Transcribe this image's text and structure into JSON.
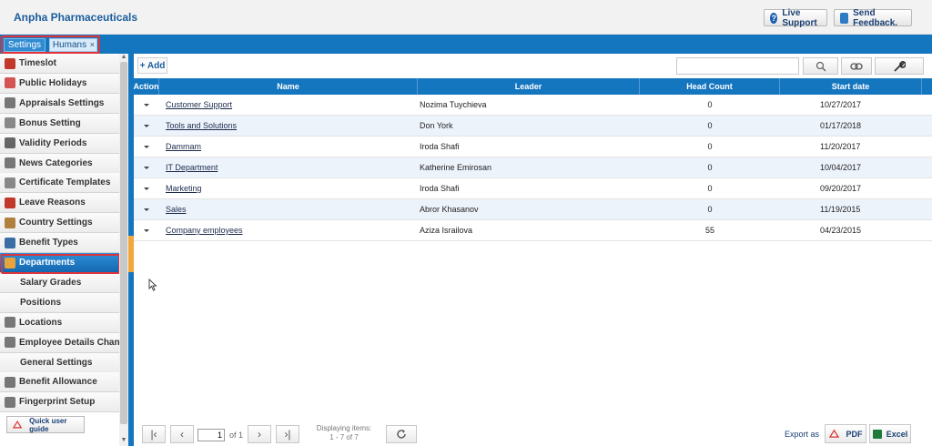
{
  "header": {
    "title": "Anpha Pharmaceuticals",
    "live_support": "Live Support",
    "send_feedback": "Send Feedback."
  },
  "tabs": [
    {
      "label": "Settings"
    },
    {
      "label": "Humans",
      "close": "×"
    }
  ],
  "sidebar": {
    "items": [
      {
        "label": "Timeslot",
        "icon": "clock-icon",
        "color": "#c0392b"
      },
      {
        "label": "Public Holidays",
        "icon": "holiday-icon",
        "color": "#d35454"
      },
      {
        "label": "Appraisals Settings",
        "icon": "people-icon",
        "color": "#777777"
      },
      {
        "label": "Bonus Setting",
        "icon": "bonus-icon",
        "color": "#888888"
      },
      {
        "label": "Validity Periods",
        "icon": "clock-icon",
        "color": "#666666"
      },
      {
        "label": "News Categories",
        "icon": "news-icon",
        "color": "#777777"
      },
      {
        "label": "Certificate Templates",
        "icon": "certificate-icon",
        "color": "#888888"
      },
      {
        "label": "Leave Reasons",
        "icon": "calendar-icon",
        "color": "#c0392b"
      },
      {
        "label": "Country Settings",
        "icon": "globe-icon",
        "color": "#b08040"
      },
      {
        "label": "Benefit Types",
        "icon": "benefit-icon",
        "color": "#3a6ea5"
      },
      {
        "label": "Departments",
        "icon": "department-icon",
        "color": "#e8a33a"
      },
      {
        "label": "Salary Grades",
        "icon": "",
        "color": ""
      },
      {
        "label": "Positions",
        "icon": "",
        "color": ""
      },
      {
        "label": "Locations",
        "icon": "flag-icon",
        "color": "#777777"
      },
      {
        "label": "Employee Details Changes",
        "icon": "employee-icon",
        "color": "#777777"
      },
      {
        "label": "General Settings",
        "icon": "",
        "color": ""
      },
      {
        "label": "Benefit Allowance",
        "icon": "allowance-icon",
        "color": "#777777"
      },
      {
        "label": "Fingerprint Setup",
        "icon": "fingerprint-icon",
        "color": "#777777"
      }
    ],
    "guide": "Quick user guide"
  },
  "toolbar": {
    "add": "+ Add",
    "search_value": ""
  },
  "table": {
    "columns": [
      "Action",
      "Name",
      "Leader",
      "Head Count",
      "Start date"
    ],
    "rows": [
      {
        "name": "Customer Support",
        "leader": "Nozima Tuychieva",
        "count": "0",
        "date": "10/27/2017"
      },
      {
        "name": "Tools and Solutions",
        "leader": "Don York",
        "count": "0",
        "date": "01/17/2018"
      },
      {
        "name": "Dammam",
        "leader": "Iroda Shafi",
        "count": "0",
        "date": "11/20/2017"
      },
      {
        "name": "IT Department",
        "leader": "Katherine Emirosan",
        "count": "0",
        "date": "10/04/2017"
      },
      {
        "name": "Marketing",
        "leader": "Iroda Shafi",
        "count": "0",
        "date": "09/20/2017"
      },
      {
        "name": "Sales",
        "leader": "Abror Khasanov",
        "count": "0",
        "date": "11/19/2015"
      },
      {
        "name": "Company employees",
        "leader": "Aziza Israilova",
        "count": "55",
        "date": "04/23/2015"
      }
    ]
  },
  "pager": {
    "page": "1",
    "of": "of",
    "total": "1",
    "displaying": "Displaying items:",
    "range": "1 - 7 of 7"
  },
  "export": {
    "label": "Export as",
    "pdf": "PDF",
    "excel": "Excel"
  },
  "colors": {
    "accent": "#1576c0",
    "title": "#1b5e9c",
    "highlight": "#e0343a"
  }
}
